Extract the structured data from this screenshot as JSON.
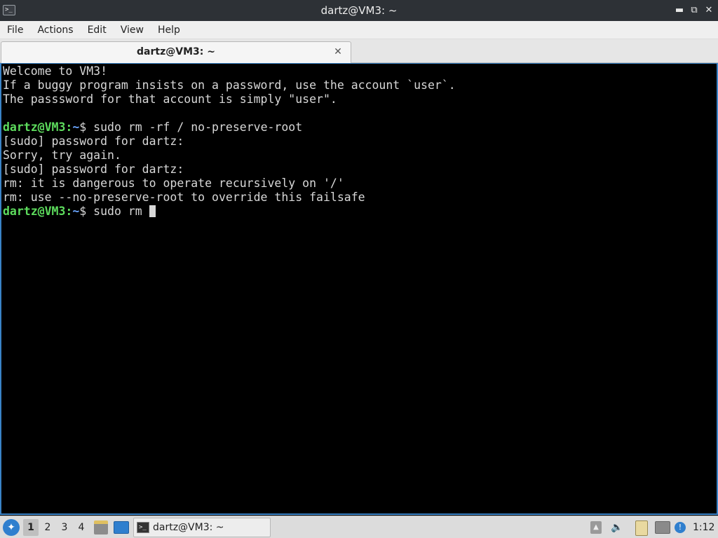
{
  "window": {
    "title": "dartz@VM3: ~",
    "app_icon_glyph": ">_",
    "minimize_glyph": "▬",
    "restore_glyph": "⧉",
    "close_glyph": "✕"
  },
  "menu": [
    "File",
    "Actions",
    "Edit",
    "View",
    "Help"
  ],
  "tab": {
    "label": "dartz@VM3: ~",
    "close_glyph": "✕"
  },
  "terminal": {
    "lines": [
      {
        "text": "Welcome to VM3!"
      },
      {
        "text": "If a buggy program insists on a password, use the account `user`."
      },
      {
        "text": "The passsword for that account is simply \"user\"."
      },
      {
        "text": ""
      },
      {
        "prompt_user": "dartz@VM3",
        "prompt_sep": ":",
        "prompt_path": "~",
        "prompt_sym": "$ ",
        "text": "sudo rm -rf / no-preserve-root"
      },
      {
        "text": "[sudo] password for dartz:"
      },
      {
        "text": "Sorry, try again."
      },
      {
        "text": "[sudo] password for dartz:"
      },
      {
        "text": "rm: it is dangerous to operate recursively on '/'"
      },
      {
        "text": "rm: use --no-preserve-root to override this failsafe"
      },
      {
        "prompt_user": "dartz@VM3",
        "prompt_sep": ":",
        "prompt_path": "~",
        "prompt_sym": "$ ",
        "text": "sudo rm ",
        "cursor": true
      }
    ]
  },
  "taskbar": {
    "workspaces": [
      "1",
      "2",
      "3",
      "4"
    ],
    "active_workspace": "1",
    "task_label": "dartz@VM3: ~",
    "clock": "1:12",
    "icons": {
      "start": "start-menu-icon",
      "file_manager": "file-manager-icon",
      "desktop": "show-desktop-icon",
      "eject": "eject-icon",
      "volume": "volume-icon",
      "clipboard": "clipboard-icon",
      "network": "network-icon",
      "info": "notification-icon"
    }
  },
  "colors": {
    "prompt_user": "#5ddc5d",
    "prompt_path": "#6aa6ff",
    "terminal_bg": "#000000",
    "terminal_fg": "#d8d8d8",
    "focus_border": "#3a83c7"
  }
}
